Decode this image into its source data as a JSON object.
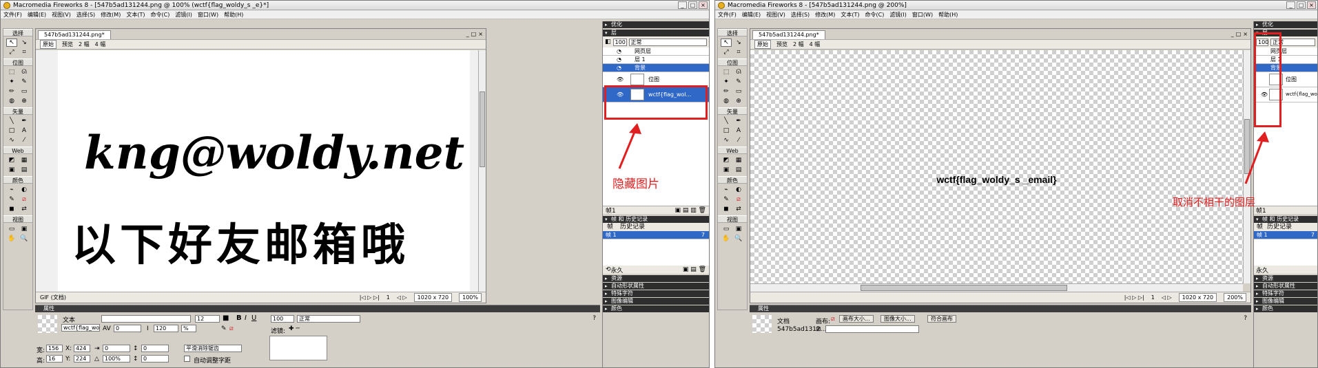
{
  "menu": [
    "文件(F)",
    "编辑(E)",
    "视图(V)",
    "选择(S)",
    "修改(M)",
    "文本(T)",
    "命令(C)",
    "滤镜(I)",
    "窗口(W)",
    "帮助(H)"
  ],
  "tools": {
    "select": "选择",
    "bitmap": "位图",
    "vector": "矢量",
    "web": "Web",
    "colors": "颜色",
    "view": "视图"
  },
  "panels": {
    "optimize": "优化",
    "layers": "层",
    "opacity": "100",
    "blend": "正常",
    "frames_history": "帧 和 历史记录",
    "frames_tab": "帧",
    "history_tab": "历史记录",
    "frame_label": "帧1",
    "frame_count": "7",
    "frame_name": "帧 1",
    "forever": "永久",
    "collapsed": [
      "资源",
      "自动形状属性",
      "特殊字符",
      "图像编辑",
      "颜色"
    ]
  },
  "layers": {
    "web_layer": "网页层",
    "layer1": "层 1",
    "background": "背景",
    "bitmap": "位图",
    "text_obj": "wctf{flag_wol..."
  },
  "viewtabs": [
    "原始",
    "预览",
    "2 幅",
    "4 幅"
  ],
  "left": {
    "title": "Macromedia Fireworks 8 - [547b5ad131244.png @ 100% (wctf{flag_woldy_s _e}*]",
    "doc_tab": "547b5ad131244.png*",
    "handwriting_line1": "kng@woldy.net",
    "handwriting_line2": "以下好友邮箱哦",
    "status_left": "GIF (文档)",
    "size": "1020 x 720",
    "zoom": "100%",
    "page": "1",
    "annotation": "隐藏图片",
    "props": {
      "header": "属性",
      "type": "文本",
      "name": "wctf{flag_wo",
      "font_size": "12",
      "w_label": "宽:",
      "w": "156",
      "x_label": "X:",
      "x": "424",
      "h_label": "高:",
      "h": "16",
      "y_label": "Y:",
      "y": "224",
      "kern": "0",
      "leading": "120",
      "leading_unit": "%",
      "opacity": "100",
      "blend": "正常",
      "filters": "滤镜:",
      "indent": "0",
      "space": "0",
      "scale": "100%",
      "space2": "0",
      "aa": "平滑消除锯齿",
      "autokern": "自动调整字距"
    }
  },
  "right": {
    "title": "Macromedia Fireworks 8 - [547b5ad131244.png @ 200%]",
    "doc_tab": "547b5ad131244.png*",
    "canvas_text": "wctf{flag_woldy_s _email}",
    "size": "1020 x 720",
    "zoom": "200%",
    "page": "1",
    "annotation": "取消不相干的图层",
    "props": {
      "type": "文档",
      "name": "547b5ad1312...",
      "canvas_label": "画布:",
      "canvas_size_btn": "画布大小...",
      "image_size_btn": "图像大小...",
      "fit_btn": "符合画布"
    }
  }
}
